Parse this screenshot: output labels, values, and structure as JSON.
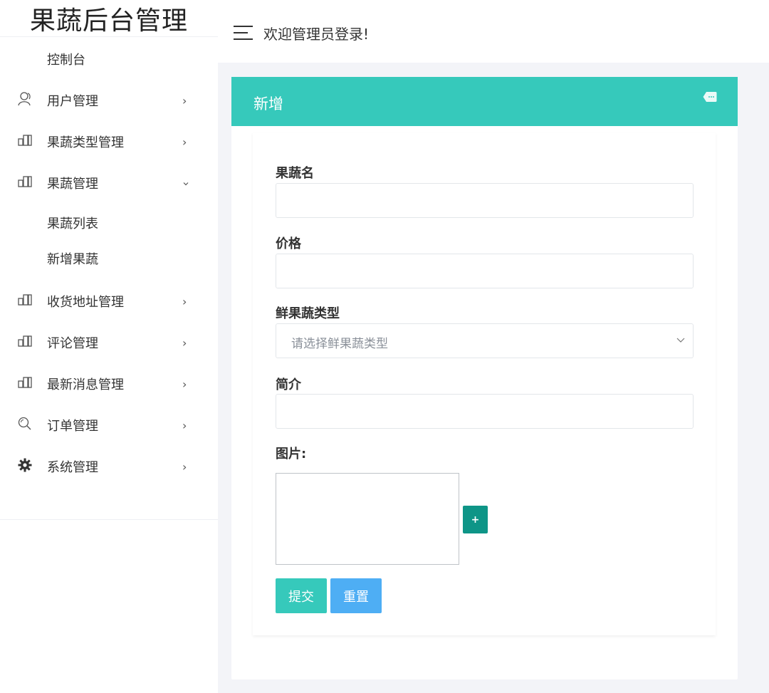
{
  "brand": {
    "title": "果蔬后台管理"
  },
  "header": {
    "welcome": "欢迎管理员登录!"
  },
  "sidebar": {
    "items": [
      {
        "label": "控制台",
        "icon": "none",
        "arrow": ""
      },
      {
        "label": "用户管理",
        "icon": "user-icon",
        "arrow": "›"
      },
      {
        "label": "果蔬类型管理",
        "icon": "grid-icon",
        "arrow": "›"
      },
      {
        "label": "果蔬管理",
        "icon": "grid-icon",
        "arrow": "⌄",
        "expanded": true
      },
      {
        "label": "收货地址管理",
        "icon": "grid-icon",
        "arrow": "›"
      },
      {
        "label": "评论管理",
        "icon": "grid-icon",
        "arrow": "›"
      },
      {
        "label": "最新消息管理",
        "icon": "grid-icon",
        "arrow": "›"
      },
      {
        "label": "订单管理",
        "icon": "search-icon",
        "arrow": "›"
      },
      {
        "label": "系统管理",
        "icon": "gear-icon",
        "arrow": "›"
      }
    ],
    "submenu": [
      {
        "label": "果蔬列表"
      },
      {
        "label": "新增果蔬"
      }
    ]
  },
  "card": {
    "title": "新增",
    "fields": {
      "name": {
        "label": "果蔬名",
        "value": ""
      },
      "price": {
        "label": "价格",
        "value": ""
      },
      "type": {
        "label": "鲜果蔬类型",
        "placeholder": "请选择鲜果蔬类型"
      },
      "intro": {
        "label": "简介",
        "value": ""
      },
      "image": {
        "label": "图片:"
      }
    },
    "add_button": "+",
    "submit_button": "提交",
    "reset_button": "重置"
  },
  "colors": {
    "accent": "#36c9bb",
    "add_button": "#0e9587",
    "reset_button": "#4eaef4",
    "page_background": "#f3f4f8"
  }
}
